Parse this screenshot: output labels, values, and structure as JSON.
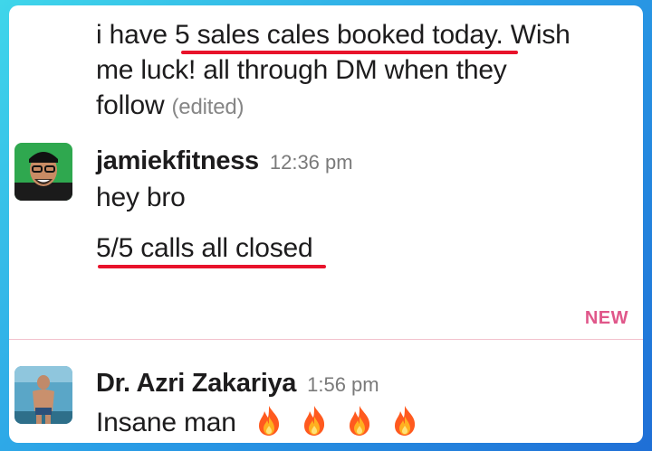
{
  "messages": [
    {
      "lines": [
        "i have 5 sales cales booked today. Wish",
        "me luck! all through DM when they",
        "follow"
      ],
      "edited": "(edited)"
    },
    {
      "author": "jamiekfitness",
      "time": "12:36 pm",
      "lines": [
        "hey bro",
        "5/5 calls all closed"
      ],
      "avatar": "avatar-jamiekfitness"
    },
    {
      "author": "Dr. Azri Zakariya",
      "time": "1:56 pm",
      "text": "Insane man",
      "emojis": [
        "fire-emoji",
        "fire-emoji",
        "fire-emoji",
        "fire-emoji"
      ],
      "avatar": "avatar-azri"
    }
  ],
  "new_divider": {
    "label": "NEW"
  },
  "colors": {
    "underline": "#e8132b",
    "new": "#e0578a"
  }
}
